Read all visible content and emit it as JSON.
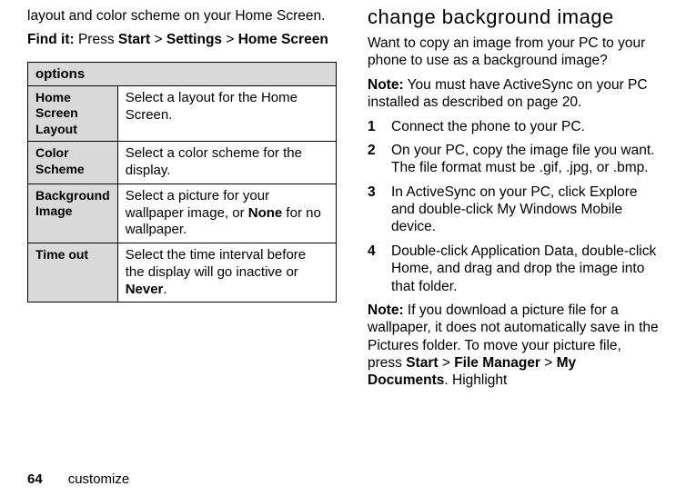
{
  "left": {
    "intro": "layout and color scheme on your Home Screen.",
    "findit_label": "Find it:",
    "findit_press": " Press ",
    "crumb_start": "Start",
    "crumb_sep": " > ",
    "crumb_settings": "Settings",
    "crumb_home": "Home Screen",
    "table": {
      "header": "options",
      "rows": [
        {
          "label": "Home Screen Layout",
          "desc": "Select a layout for the Home Screen."
        },
        {
          "label": "Color Scheme",
          "desc": "Select a color scheme for the display."
        },
        {
          "label": "Background Image",
          "desc_pre": "Select a picture for your wallpaper image, or ",
          "bold1": "None",
          "desc_post": " for no wallpaper."
        },
        {
          "label": "Time out",
          "desc_pre": "Select the time interval before the display will go inactive or ",
          "bold1": "Never",
          "desc_post": "."
        }
      ]
    }
  },
  "right": {
    "heading": "change background image",
    "intro": "Want to copy an image from your PC to your phone to use as a background image?",
    "note1_label": "Note:",
    "note1_text": "  You must have ActiveSync on your PC installed as described on page 20.",
    "steps": [
      {
        "n": "1",
        "text": "Connect the phone to your PC."
      },
      {
        "n": "2",
        "text": "On your PC, copy the image file you want. The file format must be .gif, .jpg, or .bmp."
      },
      {
        "n": "3",
        "text": "In ActiveSync on your PC, click Explore and double-click My Windows Mobile device."
      },
      {
        "n": "4",
        "text": "Double-click Application Data, double-click Home, and drag and drop the image into that folder."
      }
    ],
    "note2_label": "Note:",
    "note2_pre": " If you download a picture file for a wallpaper, it does not automatically save in the Pictures folder. To move your picture file, press ",
    "note2_start": "Start",
    "note2_sep1": " > ",
    "note2_fm": "File Manager",
    "note2_sep2": " > ",
    "note2_mydocs": "My Documents",
    "note2_post": ". Highlight"
  },
  "footer": {
    "page": "64",
    "section": "customize"
  }
}
